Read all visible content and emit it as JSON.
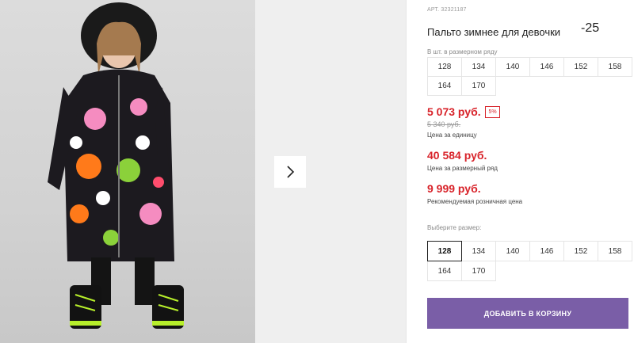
{
  "product": {
    "article": "АРТ. 32321187",
    "title": "Пальто зимнее для девочки",
    "note": "-25"
  },
  "sizes_hint": "В шт. в размерном ряду",
  "sizes_top": [
    "128",
    "134",
    "140",
    "146",
    "152",
    "158",
    "164",
    "170"
  ],
  "price": {
    "current": "5 073 руб.",
    "discount_badge": "5%",
    "old": "5 340 руб.",
    "unit_caption": "Цена за единицу",
    "range_price": "40 584 руб.",
    "range_caption": "Цена за размерный ряд",
    "rrp": "9 999 руб.",
    "rrp_caption": "Рекомендуемая розничная цена"
  },
  "size_picker": {
    "label": "Выберите размер:",
    "options": [
      "128",
      "134",
      "140",
      "146",
      "152",
      "158",
      "164",
      "170"
    ],
    "selected": "128"
  },
  "cart_button": "ДОБАВИТЬ В КОРЗИНУ",
  "gallery": {
    "next_icon": "chevron-right-icon"
  },
  "colors": {
    "price_red": "#d8232a",
    "button_purple": "#7a5ea7"
  }
}
